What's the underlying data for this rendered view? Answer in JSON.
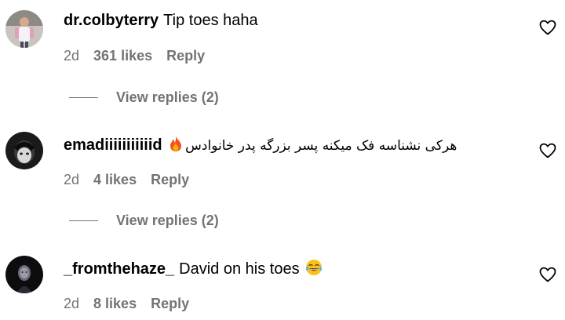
{
  "comments": [
    {
      "username": "dr.colbyterry",
      "text": "Tip toes haha",
      "time": "2d",
      "likes": "361 likes",
      "reply": "Reply",
      "avatar_icon": "profile-photo-man-standing",
      "view_replies": "View replies (2)"
    },
    {
      "username": "emadiiiiiiiiiiid",
      "emoji_icon": "fire-icon",
      "text": "هرکی نشناسه فک میکنه پسر بزرگه پدر خانوادس",
      "time": "2d",
      "likes": "4 likes",
      "reply": "Reply",
      "avatar_icon": "profile-photo-dark-face",
      "view_replies": "View replies (2)"
    },
    {
      "username": "_fromthehaze_",
      "text": "David on his toes",
      "emoji_icon": "face-with-tears-of-joy-icon",
      "time": "2d",
      "likes": "8 likes",
      "reply": "Reply",
      "avatar_icon": "profile-photo-dark-figure"
    }
  ],
  "colors": {
    "primary_text": "#000000",
    "secondary_text": "#737373",
    "background": "#ffffff"
  },
  "icons": {
    "like": "heart-outline-icon"
  }
}
